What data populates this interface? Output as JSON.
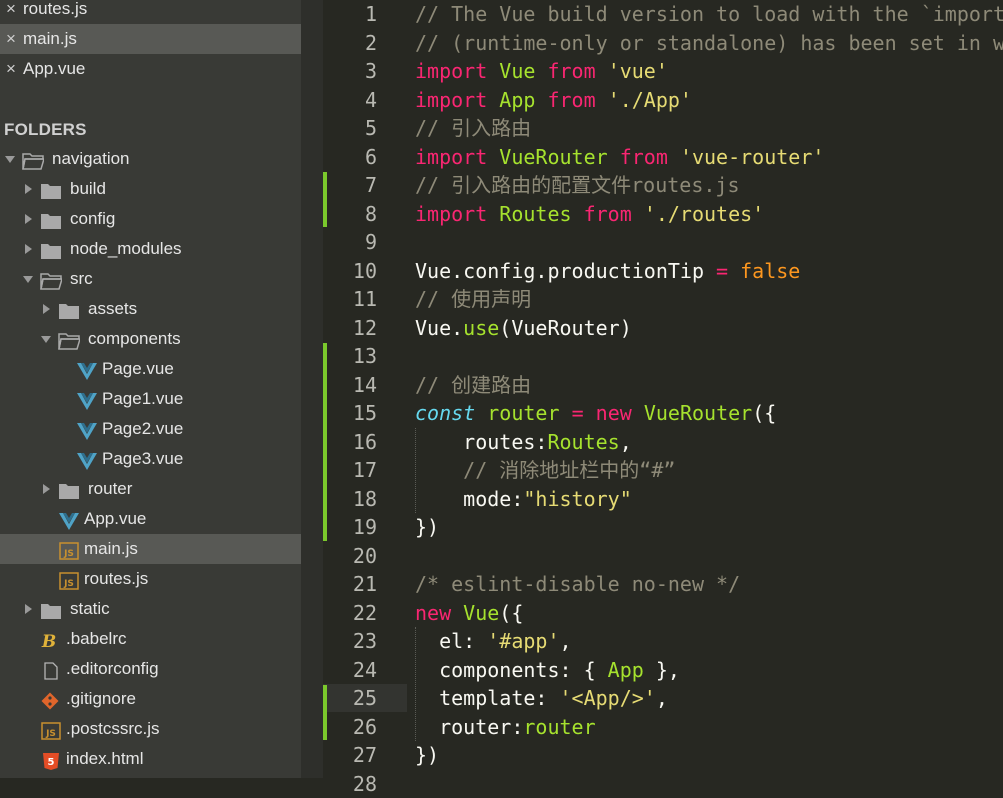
{
  "open_files": [
    {
      "label": "routes.js",
      "selected": false
    },
    {
      "label": "main.js",
      "selected": true
    },
    {
      "label": "App.vue",
      "selected": false
    }
  ],
  "folders_header": "FOLDERS",
  "tree": [
    {
      "label": "navigation",
      "depth": 0,
      "kind": "folder",
      "arrow": "open"
    },
    {
      "label": "build",
      "depth": 1,
      "kind": "folder",
      "arrow": "closed"
    },
    {
      "label": "config",
      "depth": 1,
      "kind": "folder",
      "arrow": "closed"
    },
    {
      "label": "node_modules",
      "depth": 1,
      "kind": "folder",
      "arrow": "closed"
    },
    {
      "label": "src",
      "depth": 1,
      "kind": "folder",
      "arrow": "open"
    },
    {
      "label": "assets",
      "depth": 2,
      "kind": "folder",
      "arrow": "closed"
    },
    {
      "label": "components",
      "depth": 2,
      "kind": "folder",
      "arrow": "open"
    },
    {
      "label": "Page.vue",
      "depth": 3,
      "kind": "vue"
    },
    {
      "label": "Page1.vue",
      "depth": 3,
      "kind": "vue"
    },
    {
      "label": "Page2.vue",
      "depth": 3,
      "kind": "vue"
    },
    {
      "label": "Page3.vue",
      "depth": 3,
      "kind": "vue"
    },
    {
      "label": "router",
      "depth": 2,
      "kind": "folder",
      "arrow": "closed"
    },
    {
      "label": "App.vue",
      "depth": 2,
      "kind": "vue"
    },
    {
      "label": "main.js",
      "depth": 2,
      "kind": "js",
      "selected": true
    },
    {
      "label": "routes.js",
      "depth": 2,
      "kind": "js"
    },
    {
      "label": "static",
      "depth": 1,
      "kind": "folder",
      "arrow": "closed"
    },
    {
      "label": ".babelrc",
      "depth": 1,
      "kind": "babel"
    },
    {
      "label": ".editorconfig",
      "depth": 1,
      "kind": "file"
    },
    {
      "label": ".gitignore",
      "depth": 1,
      "kind": "git"
    },
    {
      "label": ".postcssrc.js",
      "depth": 1,
      "kind": "js"
    },
    {
      "label": "index.html",
      "depth": 1,
      "kind": "html"
    }
  ],
  "icon_text": {
    "js": "JS",
    "html": "5",
    "babel": "B"
  },
  "modified_line_ranges": [
    [
      7,
      8
    ],
    [
      13,
      19
    ],
    [
      25,
      26
    ]
  ],
  "active_line": 25,
  "code_lines": [
    [
      [
        "c",
        "// The Vue build version to load with the `import` command"
      ]
    ],
    [
      [
        "c",
        "// (runtime-only or standalone) has been set in webpack.base.conf with an alias."
      ]
    ],
    [
      [
        "k",
        "import"
      ],
      [
        "p",
        " "
      ],
      [
        "f",
        "Vue"
      ],
      [
        "p",
        " "
      ],
      [
        "k",
        "from"
      ],
      [
        "p",
        " "
      ],
      [
        "s",
        "'vue'"
      ]
    ],
    [
      [
        "k",
        "import"
      ],
      [
        "p",
        " "
      ],
      [
        "f",
        "App"
      ],
      [
        "p",
        " "
      ],
      [
        "k",
        "from"
      ],
      [
        "p",
        " "
      ],
      [
        "s",
        "'./App'"
      ]
    ],
    [
      [
        "c",
        "// 引入路由"
      ]
    ],
    [
      [
        "k",
        "import"
      ],
      [
        "p",
        " "
      ],
      [
        "f",
        "VueRouter"
      ],
      [
        "p",
        " "
      ],
      [
        "k",
        "from"
      ],
      [
        "p",
        " "
      ],
      [
        "s",
        "'vue-router'"
      ]
    ],
    [
      [
        "c",
        "// 引入路由的配置文件routes.js"
      ]
    ],
    [
      [
        "k",
        "import"
      ],
      [
        "p",
        " "
      ],
      [
        "f",
        "Routes"
      ],
      [
        "p",
        " "
      ],
      [
        "k",
        "from"
      ],
      [
        "p",
        " "
      ],
      [
        "s",
        "'./routes'"
      ]
    ],
    [],
    [
      [
        "p",
        "Vue.config.productionTip "
      ],
      [
        "k",
        "="
      ],
      [
        "p",
        " "
      ],
      [
        "n",
        "false"
      ]
    ],
    [
      [
        "c",
        "// 使用声明"
      ]
    ],
    [
      [
        "p",
        "Vue."
      ],
      [
        "f",
        "use"
      ],
      [
        "p",
        "(VueRouter)"
      ]
    ],
    [],
    [
      [
        "c",
        "// 创建路由"
      ]
    ],
    [
      [
        "t",
        "const"
      ],
      [
        "p",
        " "
      ],
      [
        "f",
        "router"
      ],
      [
        "p",
        " "
      ],
      [
        "k",
        "="
      ],
      [
        "p",
        " "
      ],
      [
        "k",
        "new"
      ],
      [
        "p",
        " "
      ],
      [
        "f",
        "VueRouter"
      ],
      [
        "p",
        "({"
      ]
    ],
    [
      [
        "p",
        "    routes:"
      ],
      [
        "f",
        "Routes"
      ],
      [
        "p",
        ","
      ]
    ],
    [
      [
        "p",
        "    "
      ],
      [
        "c",
        "// 消除地址栏中的“#”"
      ]
    ],
    [
      [
        "p",
        "    mode:"
      ],
      [
        "s",
        "\"history\""
      ]
    ],
    [
      [
        "p",
        "})"
      ]
    ],
    [],
    [
      [
        "c",
        "/* eslint-disable no-new */"
      ]
    ],
    [
      [
        "k",
        "new"
      ],
      [
        "p",
        " "
      ],
      [
        "f",
        "Vue"
      ],
      [
        "p",
        "({"
      ]
    ],
    [
      [
        "p",
        "  el: "
      ],
      [
        "s",
        "'#app'"
      ],
      [
        "p",
        ","
      ]
    ],
    [
      [
        "p",
        "  components: { "
      ],
      [
        "f",
        "App"
      ],
      [
        "p",
        " },"
      ]
    ],
    [
      [
        "p",
        "  template: "
      ],
      [
        "s",
        "'<App/>'"
      ],
      [
        "p",
        ","
      ]
    ],
    [
      [
        "p",
        "  router:"
      ],
      [
        "f",
        "router"
      ]
    ],
    [
      [
        "p",
        "})"
      ]
    ],
    [
      [
        "p",
        ""
      ]
    ]
  ],
  "colors": {
    "editor_bg": "#272822",
    "sidebar_bg": "#393a36",
    "selected_row": "#585955",
    "modified_marker": "#7bc92c",
    "keyword": "#f92672",
    "string": "#e6db74",
    "function": "#a6e22e",
    "constant": "#fd971f",
    "comment": "#8e8a78"
  }
}
